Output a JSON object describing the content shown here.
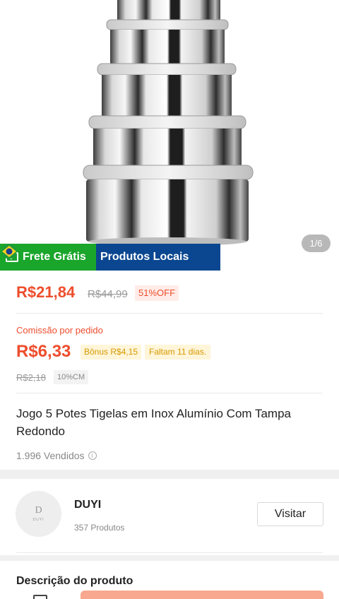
{
  "product": {
    "image_counter": "1/6",
    "badges": {
      "shipping": "Frete Grátis",
      "local": "Produtos Locais"
    },
    "price": "R$21,84",
    "original_price": "R$44,99",
    "discount": "51%OFF",
    "commission": {
      "label": "Comissão por pedido",
      "value": "R$6,33",
      "bonus": "Bônus R$4,15",
      "deadline": "Faltam 11 dias.",
      "old_value": "R$2,18",
      "rate": "10%CM"
    },
    "title": "Jogo 5 Potes Tigelas em Inox Alumínio Com Tampa Redondo",
    "sold": "1.996 Vendidos"
  },
  "shop": {
    "avatar_text": "D",
    "avatar_subtext": "DUYI",
    "name": "DUYI",
    "products": "357 Produtos",
    "visit_label": "Visitar"
  },
  "description": {
    "title": "Descrição do produto"
  },
  "colors": {
    "accent": "#ee4d2d",
    "shipping_badge": "#1aa52b",
    "local_badge": "#0b4791"
  },
  "icons": {
    "truck": "truck-icon",
    "flag": "brazil-flag-icon",
    "info": "info-icon"
  }
}
